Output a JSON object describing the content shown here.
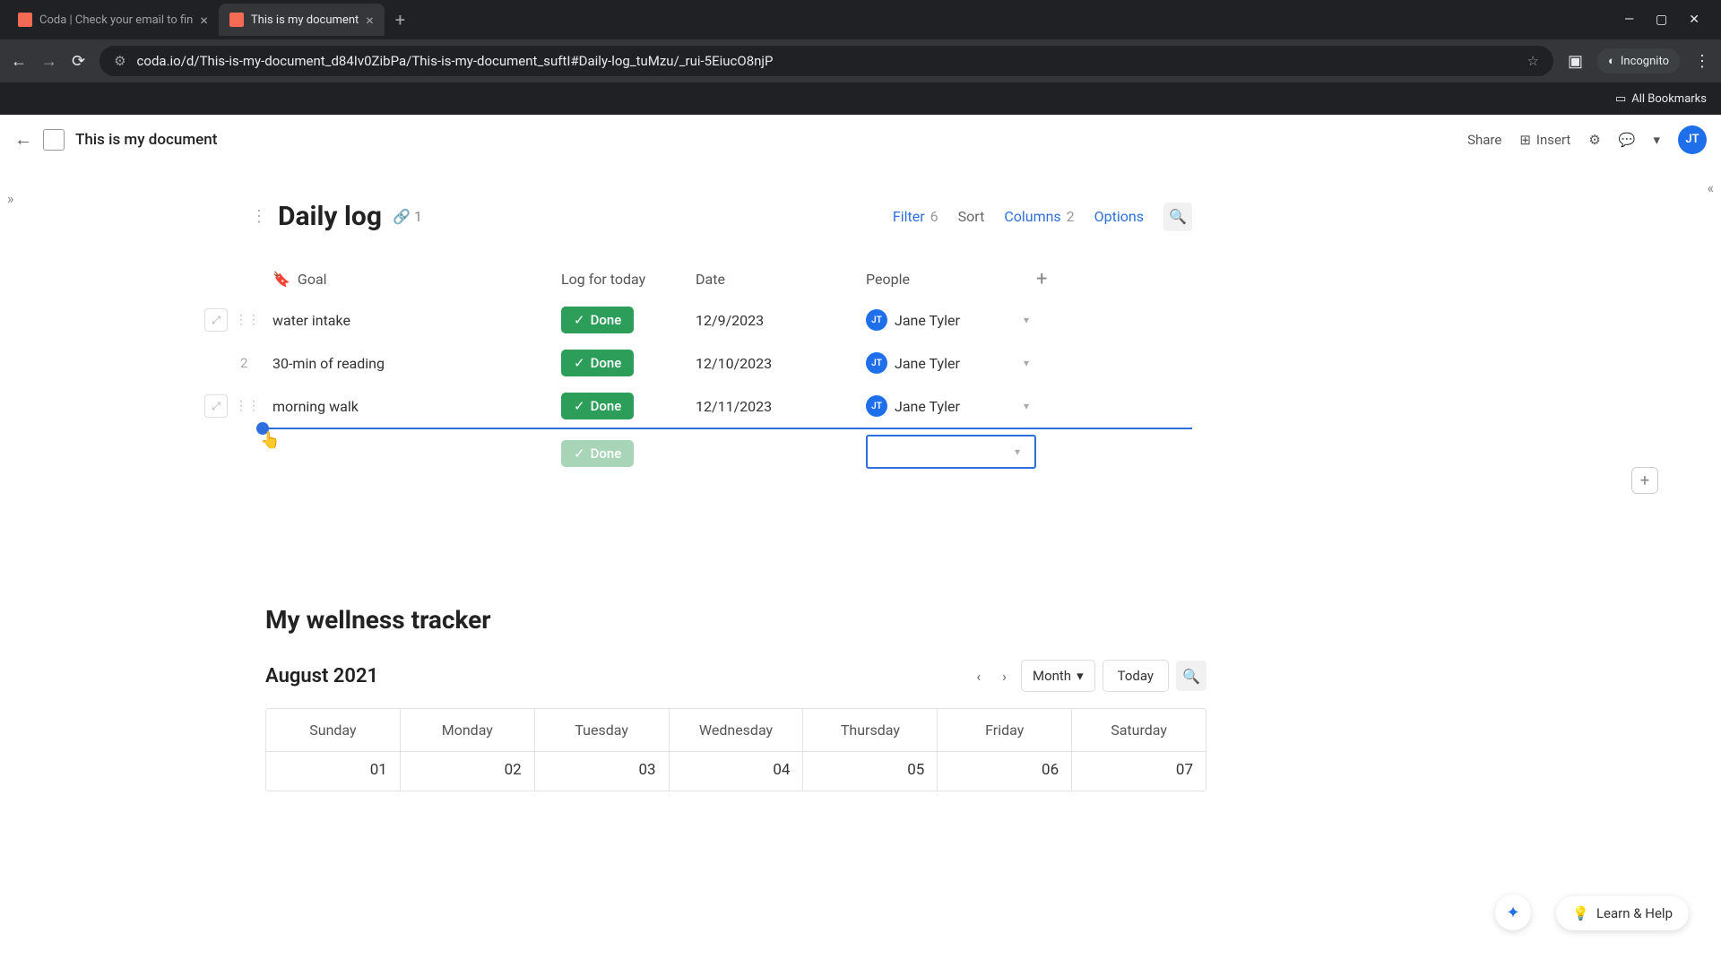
{
  "browser": {
    "tabs": [
      {
        "title": "Coda | Check your email to fin",
        "active": false
      },
      {
        "title": "This is my document",
        "active": true
      }
    ],
    "url": "coda.io/d/This-is-my-document_d84Iv0ZibPa/This-is-my-document_suftI#Daily-log_tuMzu/_rui-5EiucO8njP",
    "incognito_label": "Incognito",
    "bookmarks_label": "All Bookmarks"
  },
  "app_header": {
    "doc_title": "This is my document",
    "share": "Share",
    "insert": "Insert",
    "avatar_initials": "JT"
  },
  "daily_log": {
    "title": "Daily log",
    "link_count": "1",
    "controls": {
      "filter_label": "Filter",
      "filter_count": "6",
      "sort_label": "Sort",
      "columns_label": "Columns",
      "columns_count": "2",
      "options_label": "Options"
    },
    "columns": {
      "goal": "Goal",
      "log": "Log for today",
      "date": "Date",
      "people": "People"
    },
    "rows": [
      {
        "goal": "water intake",
        "status": "Done",
        "date": "12/9/2023",
        "person": "Jane Tyler",
        "initials": "JT"
      },
      {
        "index": "2",
        "goal": "30-min of reading",
        "status": "Done",
        "date": "12/10/2023",
        "person": "Jane Tyler",
        "initials": "JT"
      },
      {
        "goal": "morning walk",
        "status": "Done",
        "date": "12/11/2023",
        "person": "Jane Tyler",
        "initials": "JT"
      }
    ],
    "new_row_status": "Done"
  },
  "wellness": {
    "title": "My wellness tracker",
    "month_label": "August 2021",
    "view_label": "Month",
    "today_label": "Today",
    "days": [
      "Sunday",
      "Monday",
      "Tuesday",
      "Wednesday",
      "Thursday",
      "Friday",
      "Saturday"
    ],
    "dates": [
      "01",
      "02",
      "03",
      "04",
      "05",
      "06",
      "07"
    ]
  },
  "help_label": "Learn & Help"
}
